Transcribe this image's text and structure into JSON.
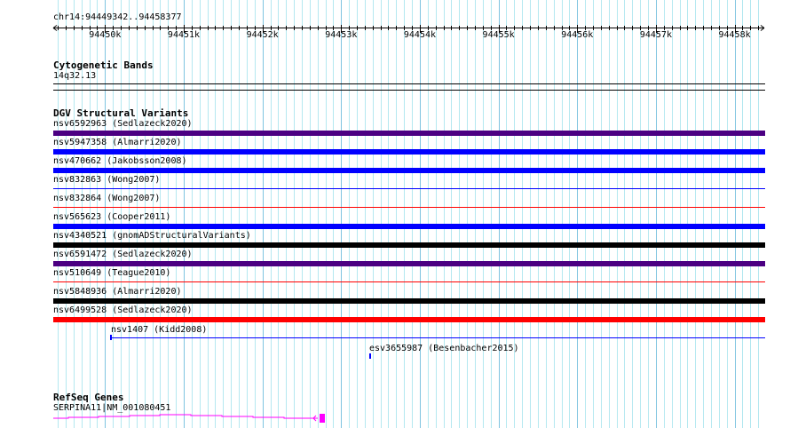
{
  "ruler": {
    "position": "chr14:94449342..94458377",
    "start": 94449342,
    "end": 94458377,
    "ticks": [
      {
        "bp": 94450000,
        "label": "94450k"
      },
      {
        "bp": 94451000,
        "label": "94451k"
      },
      {
        "bp": 94452000,
        "label": "94452k"
      },
      {
        "bp": 94453000,
        "label": "94453k"
      },
      {
        "bp": 94454000,
        "label": "94454k"
      },
      {
        "bp": 94455000,
        "label": "94455k"
      },
      {
        "bp": 94456000,
        "label": "94456k"
      },
      {
        "bp": 94457000,
        "label": "94457k"
      },
      {
        "bp": 94458000,
        "label": "94458k"
      }
    ]
  },
  "cytoband": {
    "title": "Cytogenetic Bands",
    "band": "14q32.13"
  },
  "dgv": {
    "title": "DGV Structural Variants",
    "items": [
      {
        "label": "nsv6592963 (Sedlazeck2020)",
        "color": "#4b0082",
        "style": "thick"
      },
      {
        "label": "nsv5947358 (Almarri2020)",
        "color": "#0000ff",
        "style": "thick"
      },
      {
        "label": "nsv470662 (Jakobsson2008)",
        "color": "#0000ff",
        "style": "thick"
      },
      {
        "label": "nsv832863 (Wong2007)",
        "color": "#0000ff",
        "style": "thin"
      },
      {
        "label": "nsv832864 (Wong2007)",
        "color": "#ff0000",
        "style": "thin"
      },
      {
        "label": "nsv565623 (Cooper2011)",
        "color": "#0000ff",
        "style": "thick"
      },
      {
        "label": "nsv4340521 (gnomADStructuralVariants)",
        "color": "#000000",
        "style": "thick"
      },
      {
        "label": "nsv6591472 (Sedlazeck2020)",
        "color": "#4b0082",
        "style": "thick"
      },
      {
        "label": "nsv510649 (Teague2010)",
        "color": "#ff0000",
        "style": "thin"
      },
      {
        "label": "nsv5848936 (Almarri2020)",
        "color": "#000000",
        "style": "thick"
      },
      {
        "label": "nsv6499528 (Sedlazeck2020)",
        "color": "#ff0000",
        "style": "thick"
      }
    ],
    "partial": [
      {
        "label": "nsv1407 (Kidd2008)",
        "color": "#0000ff"
      },
      {
        "label": "esv3655987 (Besenbacher2015)",
        "color": "#0000ff"
      }
    ]
  },
  "refseq": {
    "title": "RefSeq Genes",
    "gene": "SERPINA11|NM_001080451",
    "color": "#ff00ff"
  }
}
